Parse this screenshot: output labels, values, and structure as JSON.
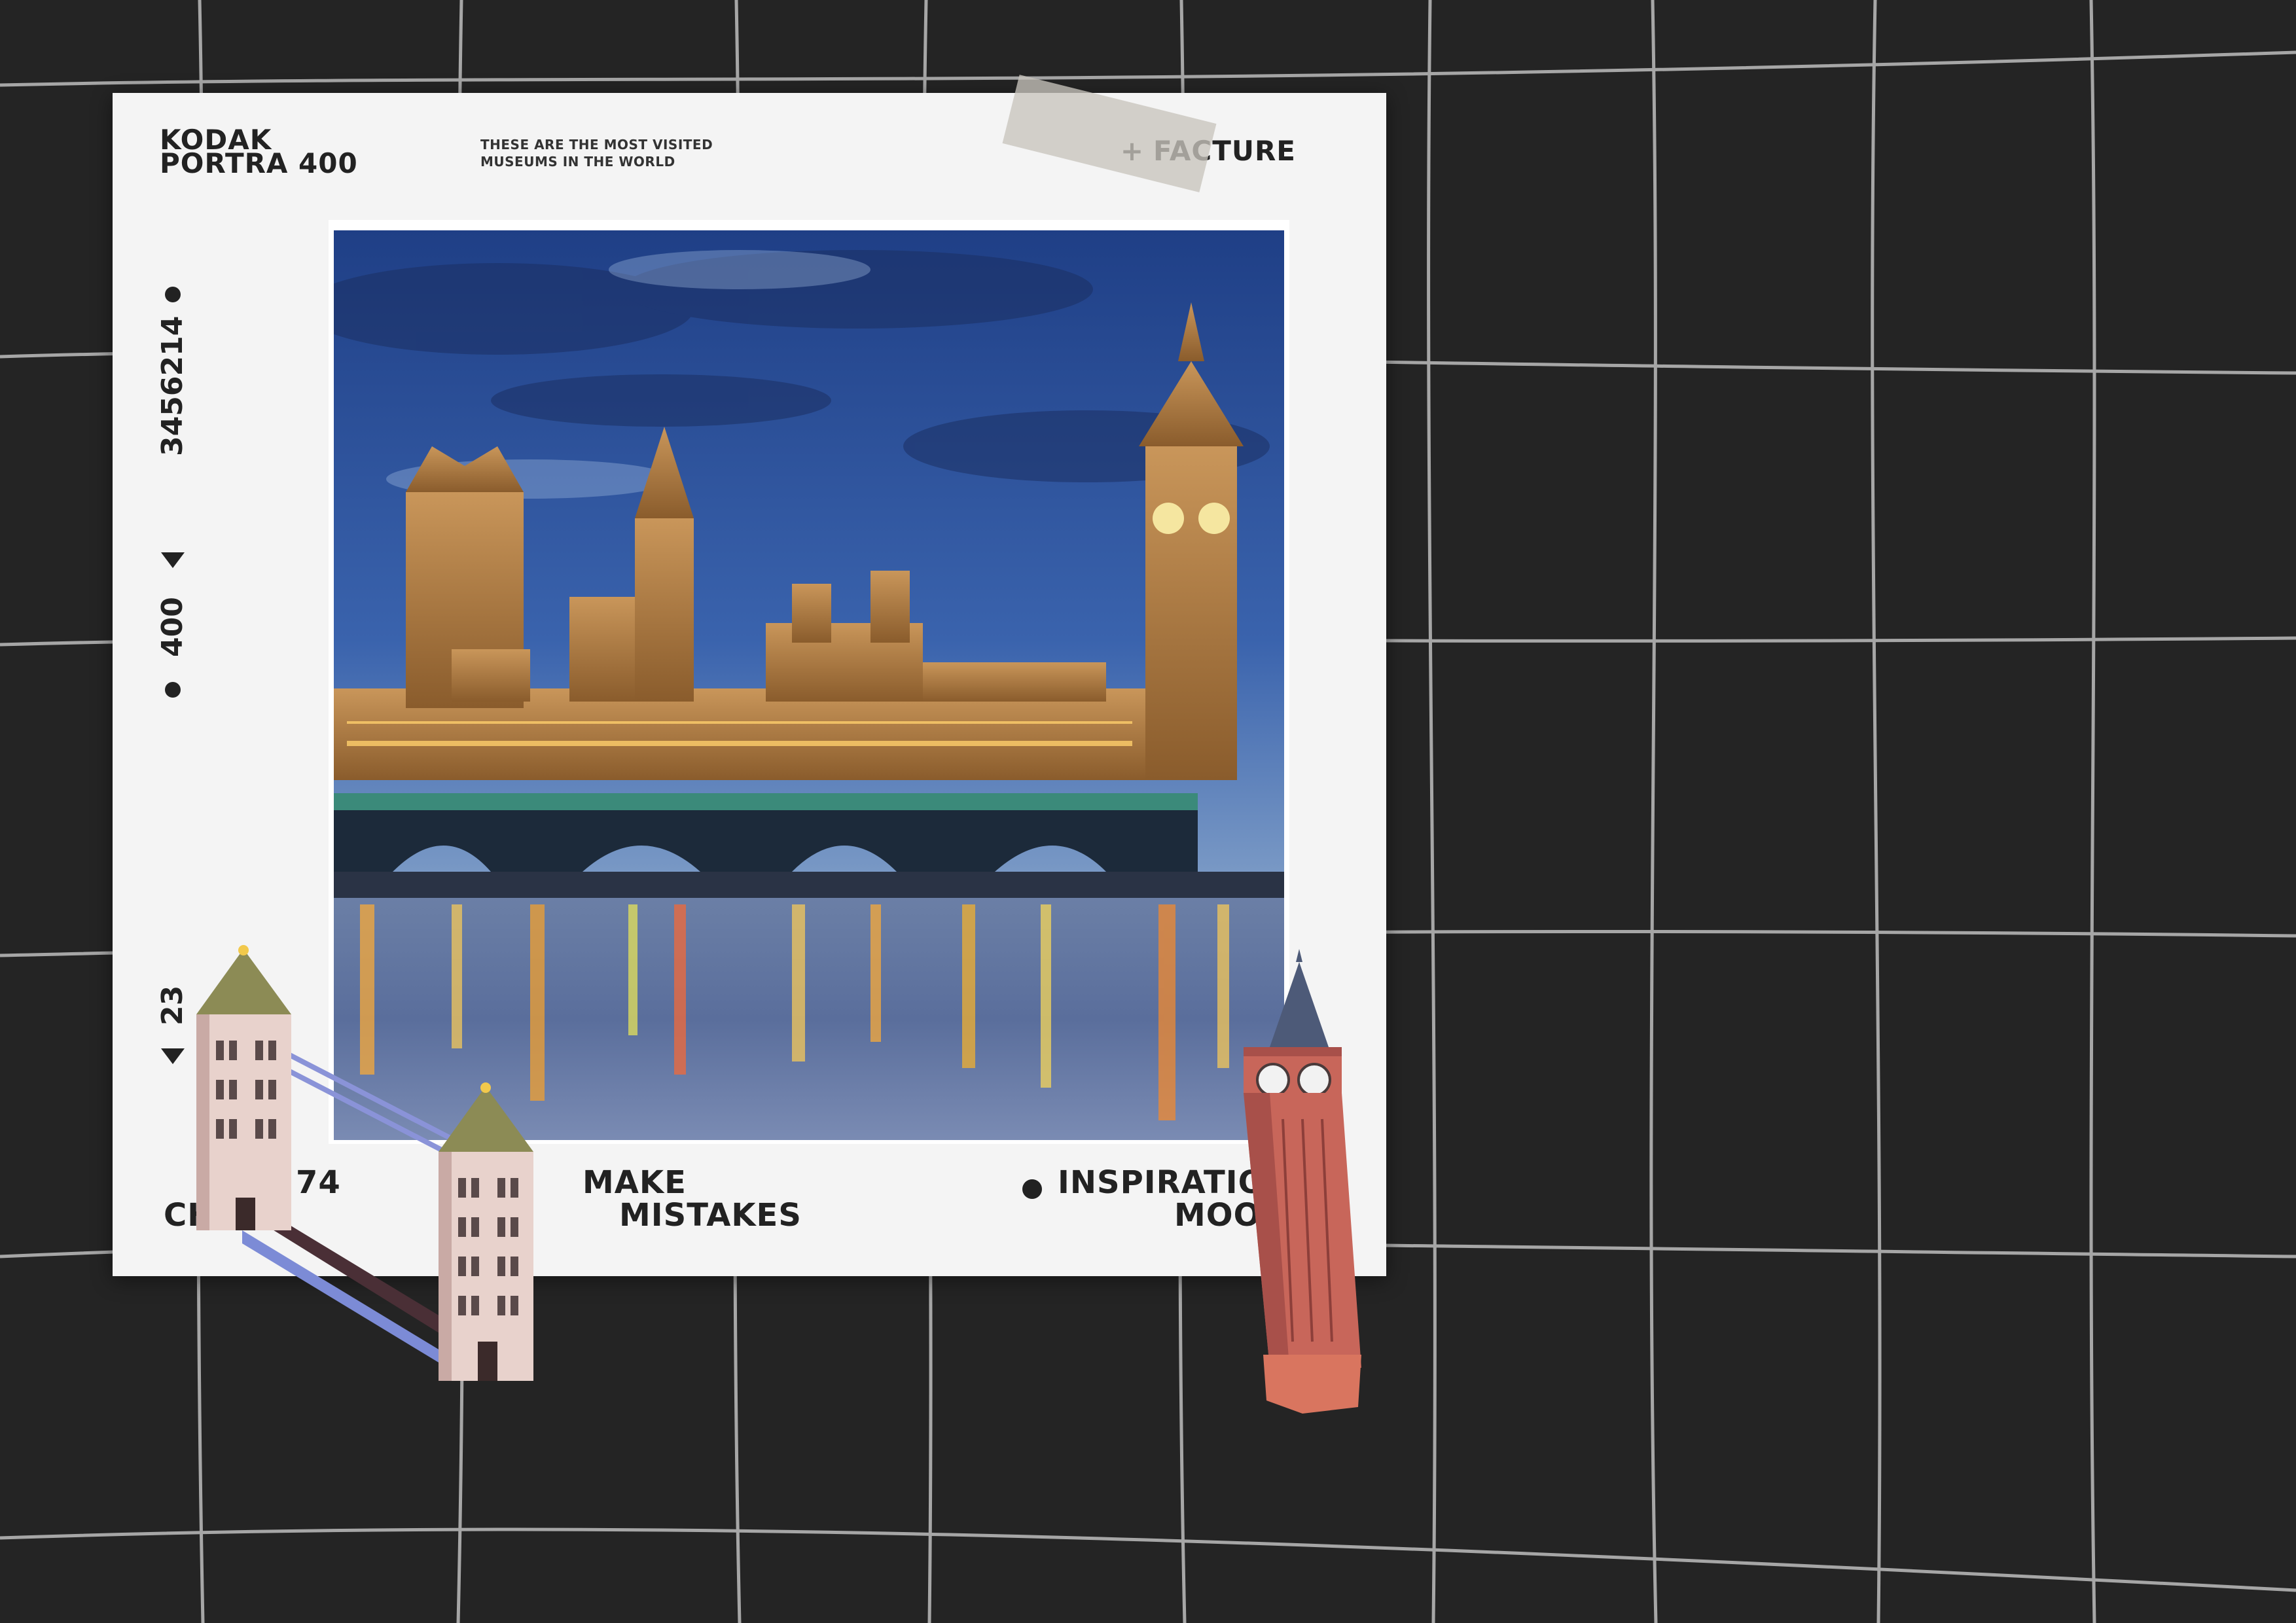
{
  "card": {
    "brand_line1": "KODAK",
    "brand_line2": "PORTRA 400",
    "tagline_line1": "THESE ARE THE MOST VISITED",
    "tagline_line2": "MUSEUMS IN THE WORLD",
    "facture_plus": "+",
    "facture_label": "FACTURE",
    "side_number_top": "3456214",
    "side_number_mid": "400",
    "side_number_low": "23",
    "bottom_left_a": "CH",
    "bottom_left_b": "74",
    "bottom_center_line1": "MAKE",
    "bottom_center_line2": "MISTAKES",
    "bottom_right_line1": "INSPIRATIO",
    "bottom_right_line2": "MOO"
  },
  "colors": {
    "background": "#242424",
    "card": "#f4f4f4",
    "ink": "#222222",
    "grid_line": "#bdbdbd",
    "clock_tower": "#c8665a",
    "tower_bridge": "#e6cdc9"
  },
  "icons": {
    "sticker_left": "tower-bridge-illustration",
    "sticker_right": "big-ben-illustration"
  }
}
